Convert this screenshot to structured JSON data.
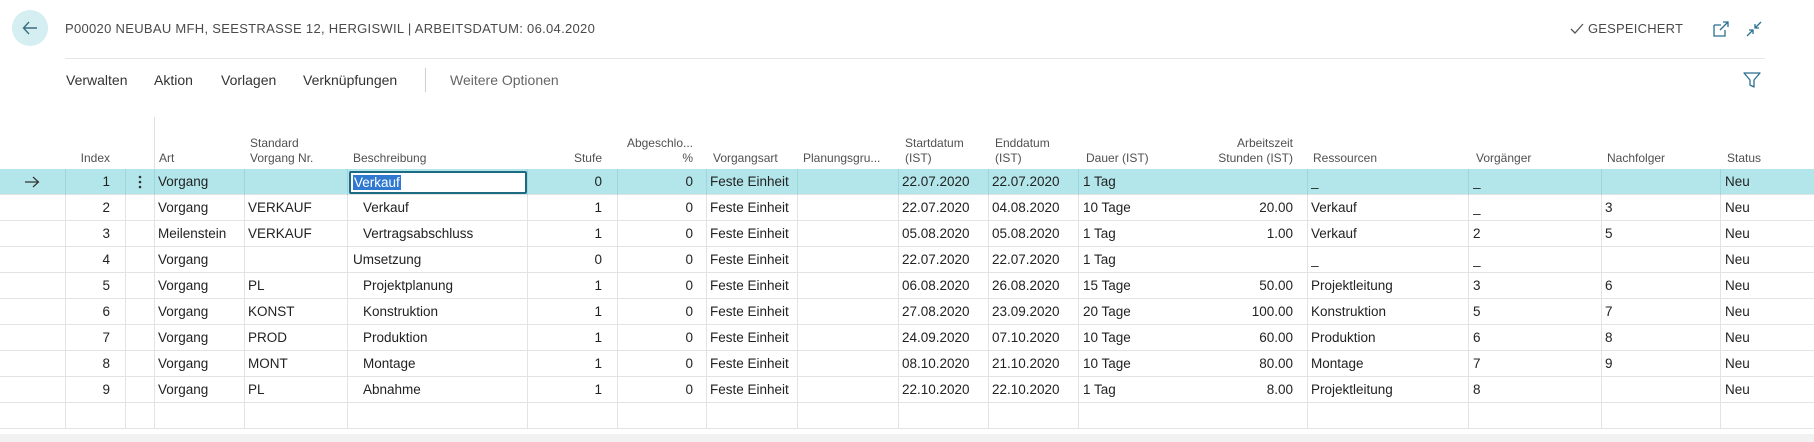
{
  "header": {
    "title": "P00020 NEUBAU MFH, SEESTRASSE 12, HERGISWIL | ARBEITSDATUM: 06.04.2020",
    "saved_label": "GESPEICHERT",
    "back_icon": "arrow-left-icon",
    "open_new_icon": "open-in-new-window-icon",
    "collapse_icon": "collapse-icon"
  },
  "menu": {
    "items": [
      "Verwalten",
      "Aktion",
      "Vorlagen",
      "Verknüpfungen"
    ],
    "more": "Weitere Optionen",
    "filter_icon": "filter-icon"
  },
  "columns": {
    "index": "Index",
    "art": "Art",
    "standard_1": "Standard",
    "standard_2": "Vorgang Nr.",
    "beschreibung": "Beschreibung",
    "stufe": "Stufe",
    "abgeschlossen_1": "Abgeschlo...",
    "abgeschlossen_2": "%",
    "vorgangsart": "Vorgangsart",
    "planungsgruppe": "Planungsgru...",
    "startdatum_1": "Startdatum",
    "startdatum_2": "(IST)",
    "enddatum_1": "Enddatum",
    "enddatum_2": "(IST)",
    "dauer": "Dauer (IST)",
    "arbeitszeit_1": "Arbeitszeit",
    "arbeitszeit_2": "Stunden (IST)",
    "ressourcen": "Ressourcen",
    "vorgaenger": "Vorgänger",
    "nachfolger": "Nachfolger",
    "status": "Status"
  },
  "rows": [
    {
      "index": "1",
      "art": "Vorgang",
      "std": "",
      "beschreibung": "Verkauf",
      "stufe": "0",
      "abg": "0",
      "vorgangsart": "Feste Einheit",
      "planung": "",
      "start": "22.07.2020",
      "ende": "22.07.2020",
      "dauer": "1 Tag",
      "stunden": "",
      "ressourcen": "_",
      "vorgaenger": "_",
      "nachfolger": "",
      "status": "Neu"
    },
    {
      "index": "2",
      "art": "Vorgang",
      "std": "VERKAUF",
      "beschreibung": "Verkauf",
      "stufe": "1",
      "abg": "0",
      "vorgangsart": "Feste Einheit",
      "planung": "",
      "start": "22.07.2020",
      "ende": "04.08.2020",
      "dauer": "10 Tage",
      "stunden": "20.00",
      "ressourcen": "Verkauf",
      "vorgaenger": "_",
      "nachfolger": "3",
      "status": "Neu"
    },
    {
      "index": "3",
      "art": "Meilenstein",
      "std": "VERKAUF",
      "beschreibung": "Vertragsabschluss",
      "stufe": "1",
      "abg": "0",
      "vorgangsart": "Feste Einheit",
      "planung": "",
      "start": "05.08.2020",
      "ende": "05.08.2020",
      "dauer": "1 Tag",
      "stunden": "1.00",
      "ressourcen": "Verkauf",
      "vorgaenger": "2",
      "nachfolger": "5",
      "status": "Neu"
    },
    {
      "index": "4",
      "art": "Vorgang",
      "std": "",
      "beschreibung": "Umsetzung",
      "stufe": "0",
      "abg": "0",
      "vorgangsart": "Feste Einheit",
      "planung": "",
      "start": "22.07.2020",
      "ende": "22.07.2020",
      "dauer": "1 Tag",
      "stunden": "",
      "ressourcen": "_",
      "vorgaenger": "_",
      "nachfolger": "",
      "status": "Neu"
    },
    {
      "index": "5",
      "art": "Vorgang",
      "std": "PL",
      "beschreibung": "Projektplanung",
      "stufe": "1",
      "abg": "0",
      "vorgangsart": "Feste Einheit",
      "planung": "",
      "start": "06.08.2020",
      "ende": "26.08.2020",
      "dauer": "15 Tage",
      "stunden": "50.00",
      "ressourcen": "Projektleitung",
      "vorgaenger": "3",
      "nachfolger": "6",
      "status": "Neu"
    },
    {
      "index": "6",
      "art": "Vorgang",
      "std": "KONST",
      "beschreibung": "Konstruktion",
      "stufe": "1",
      "abg": "0",
      "vorgangsart": "Feste Einheit",
      "planung": "",
      "start": "27.08.2020",
      "ende": "23.09.2020",
      "dauer": "20 Tage",
      "stunden": "100.00",
      "ressourcen": "Konstruktion",
      "vorgaenger": "5",
      "nachfolger": "7",
      "status": "Neu"
    },
    {
      "index": "7",
      "art": "Vorgang",
      "std": "PROD",
      "beschreibung": "Produktion",
      "stufe": "1",
      "abg": "0",
      "vorgangsart": "Feste Einheit",
      "planung": "",
      "start": "24.09.2020",
      "ende": "07.10.2020",
      "dauer": "10 Tage",
      "stunden": "60.00",
      "ressourcen": "Produktion",
      "vorgaenger": "6",
      "nachfolger": "8",
      "status": "Neu"
    },
    {
      "index": "8",
      "art": "Vorgang",
      "std": "MONT",
      "beschreibung": "Montage",
      "stufe": "1",
      "abg": "0",
      "vorgangsart": "Feste Einheit",
      "planung": "",
      "start": "08.10.2020",
      "ende": "21.10.2020",
      "dauer": "10 Tage",
      "stunden": "80.00",
      "ressourcen": "Montage",
      "vorgaenger": "7",
      "nachfolger": "9",
      "status": "Neu"
    },
    {
      "index": "9",
      "art": "Vorgang",
      "std": "PL",
      "beschreibung": "Abnahme",
      "stufe": "1",
      "abg": "0",
      "vorgangsart": "Feste Einheit",
      "planung": "",
      "start": "22.10.2020",
      "ende": "22.10.2020",
      "dauer": "1 Tag",
      "stunden": "8.00",
      "ressourcen": "Projektleitung",
      "vorgaenger": "8",
      "nachfolger": "",
      "status": "Neu"
    }
  ],
  "selected_row_index": 0,
  "row_arrow_icon": "arrow-right-icon",
  "row_menu_icon": "more-vertical-icon",
  "colors": {
    "accent": "#b3e6ea",
    "back_button": "#d4eef1",
    "edit_border": "#1d6b82",
    "text_selection": "#2f79d1"
  }
}
